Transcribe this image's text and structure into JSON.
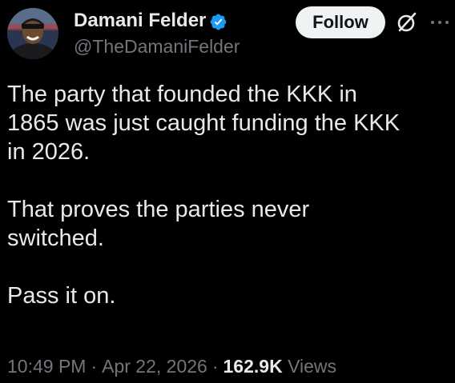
{
  "author": {
    "display_name": "Damani Felder",
    "handle": "@TheDamaniFelder",
    "verified": true,
    "avatar_icon": "profile-photo"
  },
  "actions": {
    "follow_label": "Follow",
    "grok_icon": "grok-icon",
    "more_icon": "more-icon"
  },
  "post": {
    "paragraphs": [
      "The party that founded the KKK in\n1865 was just caught funding the KKK\nin 2026.",
      "That proves the parties never\nswitched.",
      "Pass it on."
    ]
  },
  "meta": {
    "time": "10:49 PM",
    "separator": "·",
    "date": "Apr 22, 2026",
    "views_count": "162.9K",
    "views_label": "Views"
  },
  "colors": {
    "background": "#000000",
    "text_primary": "#e7e9ea",
    "text_secondary": "#71767b",
    "verified_blue": "#1d9bf0",
    "follow_bg": "#eff3f4"
  }
}
